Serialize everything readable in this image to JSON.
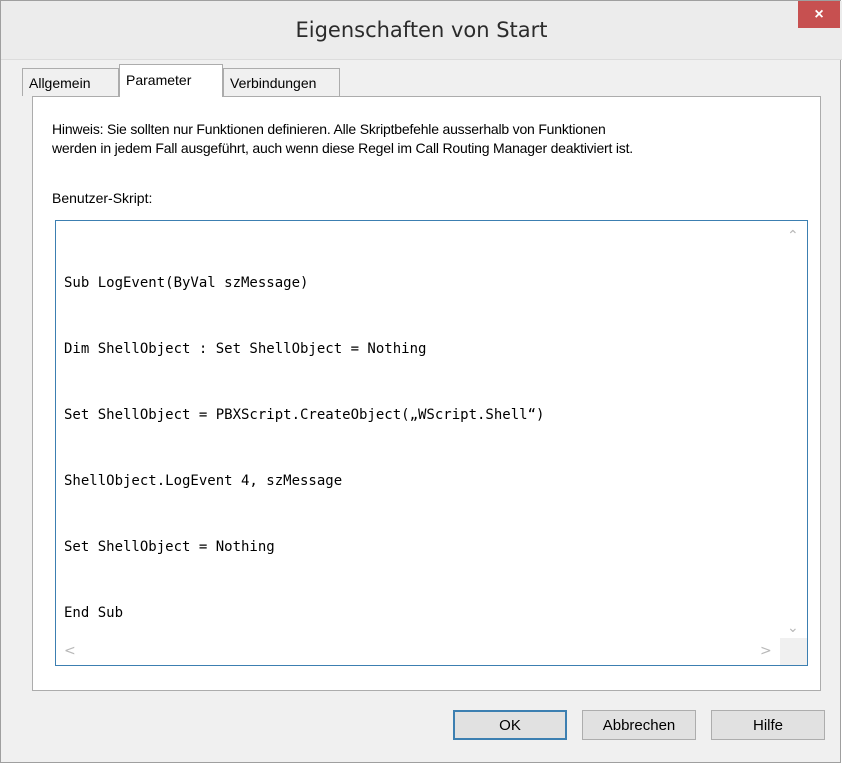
{
  "window": {
    "title": "Eigenschaften von Start",
    "close_glyph": "×"
  },
  "tabs": [
    {
      "label": "Allgemein",
      "active": false
    },
    {
      "label": "Parameter",
      "active": true
    },
    {
      "label": "Verbindungen",
      "active": false
    }
  ],
  "parameter": {
    "hint_line1": "Hinweis: Sie sollten nur Funktionen definieren. Alle Skriptbefehle ausserhalb von Funktionen",
    "hint_line2": "werden in jedem Fall ausgeführt, auch wenn diese Regel im Call Routing Manager deaktiviert ist.",
    "script_label": "Benutzer-Skript:",
    "script_lines": [
      "Sub LogEvent(ByVal szMessage)",
      "Dim ShellObject : Set ShellObject = Nothing",
      "Set ShellObject = PBXScript.CreateObject(„WScript.Shell“)",
      "ShellObject.LogEvent 4, szMessage",
      "Set ShellObject = Nothing",
      "End Sub"
    ]
  },
  "buttons": {
    "ok": "OK",
    "cancel": "Abbrechen",
    "help": "Hilfe"
  },
  "colors": {
    "close": "#c75050",
    "focus_border": "#3c7fb1"
  },
  "icons": {
    "close": "close-icon",
    "scroll_up": "chevron-up-icon",
    "scroll_down": "chevron-down-icon",
    "scroll_left": "chevron-left-icon",
    "scroll_right": "chevron-right-icon"
  }
}
